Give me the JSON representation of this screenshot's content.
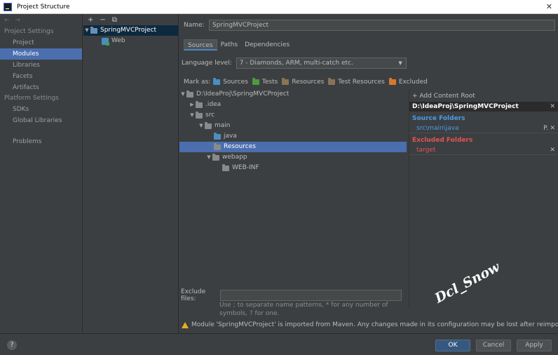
{
  "window": {
    "title": "Project Structure",
    "close_glyph": "✕"
  },
  "nav": {
    "back_glyph": "←",
    "forward_glyph": "→",
    "project_settings_title": "Project Settings",
    "project_settings_items": [
      "Project",
      "Modules",
      "Libraries",
      "Facets",
      "Artifacts"
    ],
    "platform_settings_title": "Platform Settings",
    "platform_settings_items": [
      "SDKs",
      "Global Libraries"
    ],
    "problems": "Problems",
    "selected": "Modules"
  },
  "modules": {
    "toolbar": {
      "add": "+",
      "remove": "−",
      "copy": "⧉"
    },
    "root": "SpringMVCProject",
    "child": "Web"
  },
  "settings": {
    "name_label": "Name:",
    "name_value": "SpringMVCProject",
    "tabs": [
      "Sources",
      "Paths",
      "Dependencies"
    ],
    "active_tab": "Sources",
    "language_label": "Language level:",
    "language_value": "7 - Diamonds, ARM, multi-catch etc.",
    "mark_as_label": "Mark as:",
    "mark_as": [
      "Sources",
      "Tests",
      "Resources",
      "Test Resources",
      "Excluded"
    ]
  },
  "tree": {
    "root": "D:\\IdeaProj\\SpringMVCProject",
    "idea": ".idea",
    "src": "src",
    "main": "main",
    "java": "java",
    "resources": "Resources",
    "webapp": "webapp",
    "webinf": "WEB-INF"
  },
  "roots": {
    "add_content_root": "+ Add Content Root",
    "path": "D:\\IdeaProj\\SpringMVCProject",
    "source_title": "Source Folders",
    "source_item": "src\\main\\java",
    "excluded_title": "Excluded Folders",
    "excluded_item": "target",
    "remove_glyph": "✕",
    "edit_glyph": "P.",
    "watermark": "Dcl_Snow"
  },
  "exclude": {
    "label": "Exclude files:",
    "value": "",
    "hint": "Use ; to separate name patterns, * for any number of symbols, ? for one."
  },
  "warning": "Module 'SpringMVCProject' is imported from Maven. Any changes made in its configuration may be lost after reimporting.",
  "buttons": {
    "help": "?",
    "ok": "OK",
    "cancel": "Cancel",
    "apply": "Apply"
  }
}
